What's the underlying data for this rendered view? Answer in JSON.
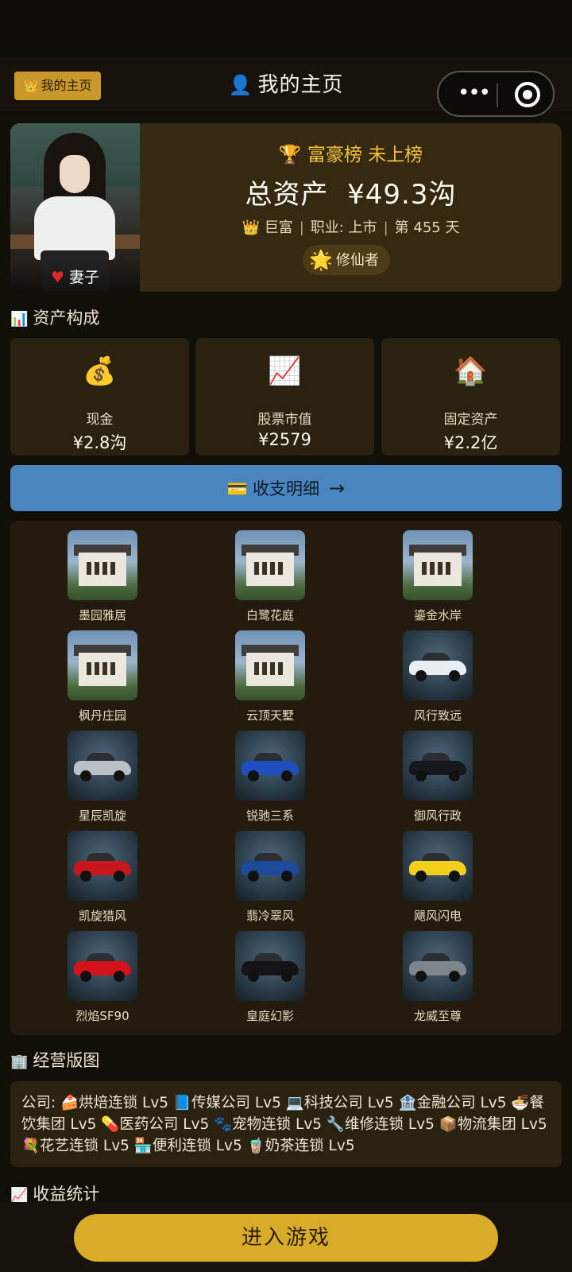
{
  "nav": {
    "home_pill": "我的主页",
    "title": "我的主页"
  },
  "profile": {
    "companion_label": "妻子",
    "rank_text": "富豪榜 未上榜",
    "total_assets_label": "总资产",
    "total_assets_value": "¥49.3沟",
    "wealth_tier": "巨富",
    "occupation": "职业: 上市",
    "day_count": "第 455 天",
    "title_badge": "修仙者"
  },
  "asset_section": {
    "title": "资产构成",
    "cards": [
      {
        "icon": "money-bag-icon",
        "label": "现金",
        "value": "¥2.8沟"
      },
      {
        "icon": "chart-increasing-icon",
        "label": "股票市值",
        "value": "¥2579"
      },
      {
        "icon": "house-icon",
        "label": "固定资产",
        "value": "¥2.2亿"
      }
    ]
  },
  "ledger_button": {
    "label": "收支明细",
    "arrow": "→"
  },
  "collection": {
    "items": [
      {
        "name": "墨园雅居",
        "kind": "house"
      },
      {
        "name": "白鹭花庭",
        "kind": "house"
      },
      {
        "name": "鎏金水岸",
        "kind": "house"
      },
      {
        "name": "枫丹庄园",
        "kind": "house"
      },
      {
        "name": "云顶天墅",
        "kind": "house"
      },
      {
        "name": "风行致远",
        "kind": "car",
        "color": "#e9eef2"
      },
      {
        "name": "星辰凯旋",
        "kind": "car",
        "color": "#b9c0c6"
      },
      {
        "name": "锐驰三系",
        "kind": "car",
        "color": "#1f4fbf"
      },
      {
        "name": "御风行政",
        "kind": "car",
        "color": "#15181c"
      },
      {
        "name": "凯旋猎风",
        "kind": "car",
        "color": "#c8161e"
      },
      {
        "name": "翡冷翠风",
        "kind": "car",
        "color": "#1d4a9b"
      },
      {
        "name": "飓风闪电",
        "kind": "car",
        "color": "#f3cf1b"
      },
      {
        "name": "烈焰SF90",
        "kind": "car",
        "color": "#d3121a"
      },
      {
        "name": "皇庭幻影",
        "kind": "car",
        "color": "#141416"
      },
      {
        "name": "龙威至尊",
        "kind": "car",
        "color": "#7d858d"
      }
    ]
  },
  "business_section": {
    "title": "经营版图",
    "text": "公司: 🍰烘焙连锁 Lv5 📘传媒公司 Lv5 💻科技公司 Lv5 🏦金融公司 Lv5 🍜餐饮集团 Lv5 💊医药公司 Lv5 🐾宠物连锁 Lv5 🔧维修连锁 Lv5 📦物流集团 Lv5 💐花艺连锁 Lv5 🏪便利连锁 Lv5 🧋奶茶连锁 Lv5"
  },
  "income_section": {
    "title": "收益统计"
  },
  "enter_button": {
    "label": "进入游戏"
  }
}
